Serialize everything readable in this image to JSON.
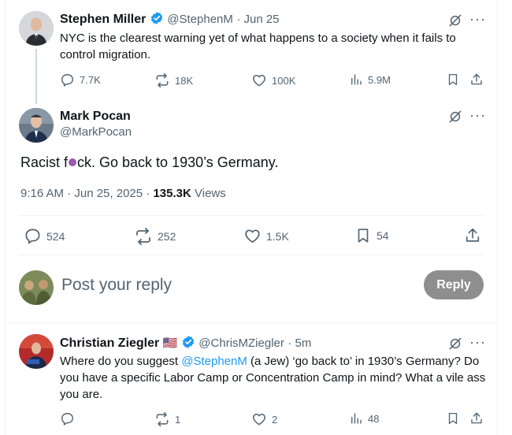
{
  "tweet1": {
    "name": "Stephen Miller",
    "handle": "@StephenM",
    "date": "· Jun 25",
    "text": "NYC is the clearest warning yet of what happens to a society when it fails to control migration.",
    "replies": "7.7K",
    "reposts": "18K",
    "likes": "100K",
    "views": "5.9M"
  },
  "main_tweet": {
    "name": "Mark Pocan",
    "handle": "@MarkPocan",
    "text_before": "Racist f",
    "text_after": "ck. Go back to 1930’s Germany.",
    "time": "9:16 AM · Jun 25, 2025 ·",
    "views_count": "135.3K",
    "views_label": "Views",
    "replies": "524",
    "reposts": "252",
    "likes": "1.5K",
    "bookmarks": "54"
  },
  "composer": {
    "placeholder": "Post your reply",
    "button": "Reply"
  },
  "reply_tweet": {
    "name": "Christian Ziegler",
    "flag": "🇺🇸",
    "handle": "@ChrisMZiegler",
    "date": "· 5m",
    "text_part1": "Where do you suggest ",
    "mention": "@StephenM",
    "text_part2": " (a Jew) ‘go back to’ in 1930’s Germany? Do you have a specific Labor Camp or Concentration Camp in mind? What a vile ass you are.",
    "replies": "",
    "reposts": "1",
    "likes": "2",
    "views": "48"
  },
  "colors": {
    "verified": "#1d9bf0",
    "accent": "#1d9bf0",
    "dot": "#9b59b6",
    "reply_button": "#8e8e8e"
  }
}
